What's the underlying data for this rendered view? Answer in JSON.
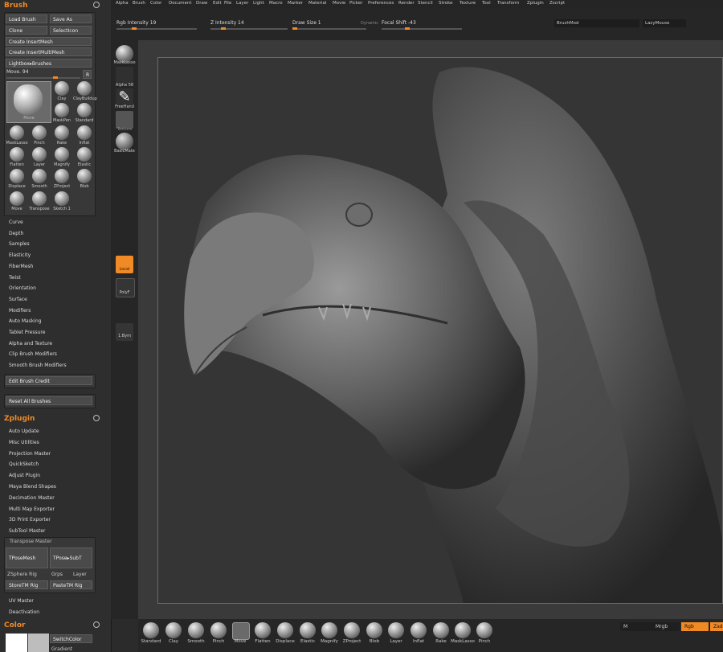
{
  "menu": [
    "Alpha",
    "Brush",
    "Color",
    "Document",
    "Draw",
    "Edit",
    "File",
    "Layer",
    "Light",
    "Macro",
    "Marker",
    "Material",
    "Movie",
    "Picker",
    "Preferences",
    "Render",
    "Stencil",
    "Stroke",
    "Texture",
    "Tool",
    "Transform",
    "Zplugin",
    "Zscript"
  ],
  "topbar": {
    "rgb_intensity": "Rgb Intensity 19",
    "z_intensity": "Z Intensity 14",
    "draw_size": "Draw Size 1",
    "dynamic": "Dynamic",
    "focal_shift": "Focal Shift -43",
    "brushmod": "BrushMod",
    "lazymouse": "LazyMouse",
    "rgb_intensity_value": 19,
    "z_intensity_value": 14,
    "draw_size_value": 1,
    "focal_shift_value": -43
  },
  "brush": {
    "title": "Brush",
    "load": "Load Brush",
    "save_as": "Save As",
    "clone": "Clone",
    "select_icon": "SelectIcon",
    "create_insertmesh": "Create InsertMesh",
    "create_insertmultimesh": "Create InsertMultiMesh",
    "lightbox": "Lightbox▸Brushes",
    "current": "Move. 94",
    "r": "R",
    "main_label": "Move",
    "thumbs": [
      "Clay",
      "ClayBuildup",
      "MaskPen",
      "Standard",
      "MaskLasso",
      "Pinch",
      "Rake",
      "Inflat",
      "Flatten",
      "Layer",
      "Magnify",
      "Elastic",
      "Displace",
      "Smooth",
      "ZProject",
      "Blob",
      "Move",
      "Transpose",
      "Sketch 1"
    ],
    "items": [
      "Curve",
      "Depth",
      "Samples",
      "Elasticity",
      "FiberMesh",
      "Twist",
      "Orientation",
      "Surface",
      "Modifiers",
      "Auto Masking",
      "Tablet Pressure",
      "Alpha and Texture",
      "Clip Brush Modifiers",
      "Smooth Brush Modifiers"
    ],
    "edit_credit": "Edit Brush Credit",
    "reset": "Reset All Brushes"
  },
  "zplugin": {
    "title": "Zplugin",
    "items": [
      "Auto Update",
      "Misc Utilities",
      "Projection Master",
      "QuickSketch",
      "Adjust Plugin",
      "Maya Blend Shapes",
      "Decimation Master",
      "Multi Map Exporter",
      "3D Print Exporter",
      "SubTool Master"
    ],
    "transpose_master": "Transpose Master",
    "tposemesh": "TPoseMesh",
    "tpose_subt": "TPose▸SubT",
    "zsphere_rig": "ZSphere Rig",
    "grps": "Grps",
    "layer": "Layer",
    "storetm_rig": "StoreTM Rig",
    "pastetm_rig": "PasteTM Rig",
    "uv_master": "UV Master",
    "deactivation": "Deactivation"
  },
  "color": {
    "title": "Color",
    "switch": "SwitchColor",
    "gradient": "Gradient"
  },
  "side": {
    "mask_lasso": "MaskLasso",
    "alpha": "Alpha 58",
    "freehand": "FreeHand",
    "texture": "Texture",
    "material": "BasicMate",
    "local": "Local",
    "polyf": "PolyF",
    "zoom": "1.Bym"
  },
  "bottom": {
    "brushes": [
      "Standard",
      "Clay",
      "Smooth",
      "Pinch",
      "Move",
      "Flatten",
      "Displace",
      "Elastic",
      "Magnify",
      "ZProject",
      "Blob",
      "Layer",
      "Inflat",
      "Rake",
      "MaskLasso",
      "Pinch"
    ],
    "m": "M",
    "mrgb": "Mrgb",
    "rgb": "Rgb",
    "zadd": "Zadd"
  },
  "colors": {
    "accent": "#f08a24"
  }
}
